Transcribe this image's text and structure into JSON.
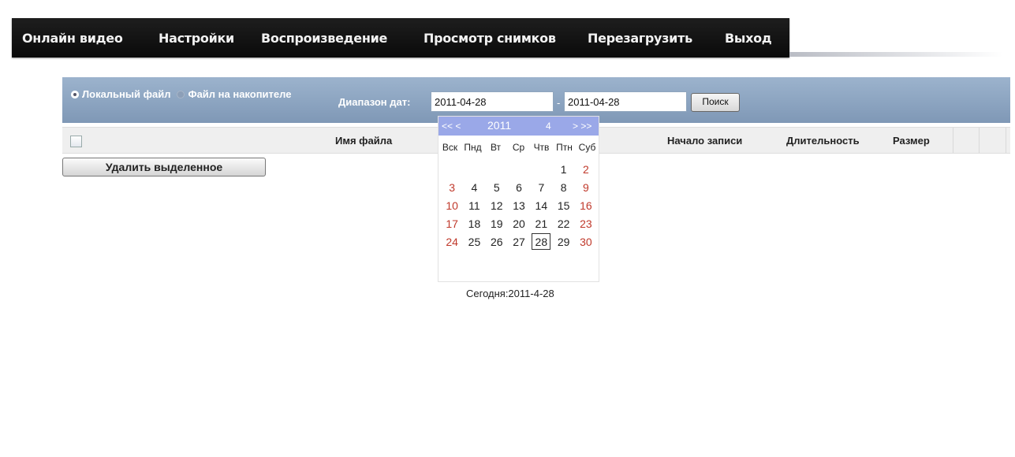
{
  "nav": {
    "items": [
      {
        "label": "Онлайн видео"
      },
      {
        "label": "Настройки"
      },
      {
        "label": "Воспроизведение"
      },
      {
        "label": "Просмотр снимков"
      },
      {
        "label": "Перезагрузить"
      },
      {
        "label": "Выход"
      }
    ]
  },
  "search": {
    "radio_local": "Локальный файл",
    "radio_storage": "Файл на накопителе",
    "date_range_label": "Диапазон дат:",
    "date_from": "2011-04-28",
    "date_to": "2011-04-28",
    "search_button": "Поиск"
  },
  "table": {
    "columns": {
      "filename": "Имя файла",
      "start": "Начало записи",
      "duration": "Длительность",
      "size": "Размер"
    },
    "delete_button": "Удалить выделенное"
  },
  "calendar": {
    "prev": "<< <",
    "year": "2011",
    "month": "4",
    "next": "> >>",
    "weekdays": [
      "Вск",
      "Пнд",
      "Вт",
      "Ср",
      "Чтв",
      "Птн",
      "Суб"
    ],
    "weeks": [
      [
        "",
        "",
        "",
        "",
        "",
        "1",
        "2"
      ],
      [
        "3",
        "4",
        "5",
        "6",
        "7",
        "8",
        "9"
      ],
      [
        "10",
        "11",
        "12",
        "13",
        "14",
        "15",
        "16"
      ],
      [
        "17",
        "18",
        "19",
        "20",
        "21",
        "22",
        "23"
      ],
      [
        "24",
        "25",
        "26",
        "27",
        "28",
        "29",
        "30"
      ]
    ],
    "selected_day": "28",
    "today_label": "Сегодня:2011-4-28"
  },
  "colors": {
    "nav_bg": "#111111",
    "bar_bg": "#8aa2bf",
    "calendar_header": "#9aa8e8",
    "weekend": "#c0392b"
  }
}
